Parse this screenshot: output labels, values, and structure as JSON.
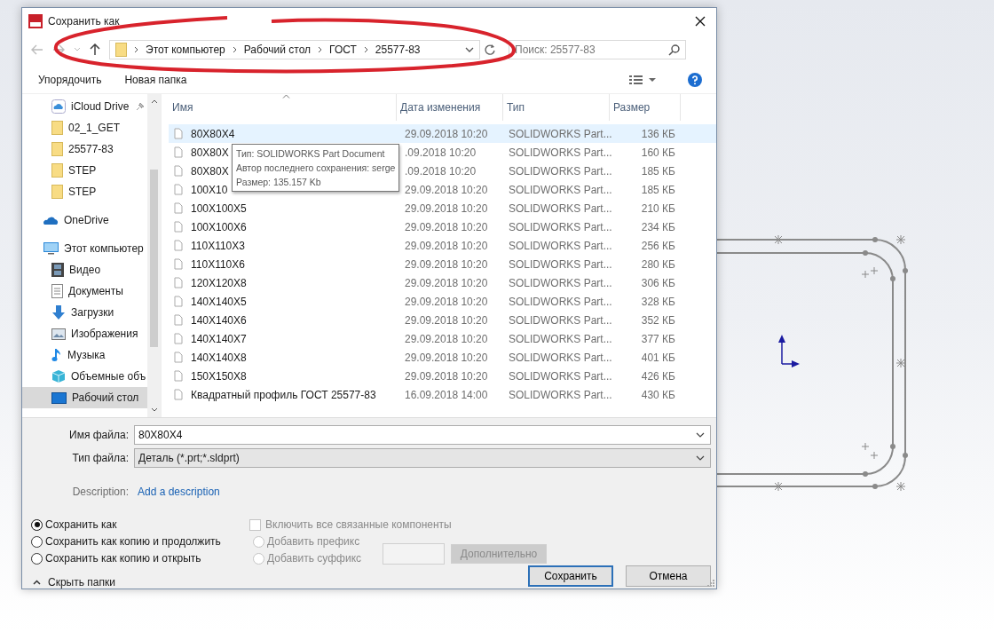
{
  "window": {
    "title": "Сохранить как"
  },
  "navigation": {
    "breadcrumb": [
      "Этот компьютер",
      "Рабочий стол",
      "ГОСТ",
      "25577-83"
    ],
    "search": {
      "placeholder": "Поиск: 25577-83"
    }
  },
  "toolbar": {
    "organize": "Упорядочить",
    "new_folder": "Новая папка"
  },
  "sidebar": {
    "quick_access_items": [
      {
        "label": "iCloud Drive",
        "kind": "cloud",
        "pinned": true,
        "selected": false
      },
      {
        "label": "02_1_GET",
        "kind": "folder",
        "pinned": false,
        "selected": false
      },
      {
        "label": "25577-83",
        "kind": "folder",
        "pinned": false,
        "selected": false
      },
      {
        "label": "STEP",
        "kind": "folder",
        "pinned": false,
        "selected": false
      },
      {
        "label": "STEP",
        "kind": "folder",
        "pinned": false,
        "selected": false
      }
    ],
    "items": [
      {
        "label": "OneDrive",
        "kind": "onedrive",
        "selected": false
      },
      {
        "label": "Этот компьютер",
        "kind": "computer",
        "selected": false,
        "children": [
          {
            "label": "Видео",
            "kind": "video",
            "selected": false
          },
          {
            "label": "Документы",
            "kind": "documents",
            "selected": false
          },
          {
            "label": "Загрузки",
            "kind": "downloads",
            "selected": false
          },
          {
            "label": "Изображения",
            "kind": "pictures",
            "selected": false
          },
          {
            "label": "Музыка",
            "kind": "music",
            "selected": false
          },
          {
            "label": "Объемные объ",
            "kind": "objects",
            "selected": false
          },
          {
            "label": "Рабочий стол",
            "kind": "desktop",
            "selected": true
          }
        ]
      }
    ]
  },
  "table": {
    "columns": [
      {
        "label": "Имя",
        "sorted": true
      },
      {
        "label": "Дата изменения",
        "sorted": false
      },
      {
        "label": "Тип",
        "sorted": false
      },
      {
        "label": "Размер",
        "sorted": false
      }
    ],
    "rows": [
      {
        "name": "80X80X4",
        "date": "29.09.2018 10:20",
        "type": "SOLIDWORKS Part...",
        "size": "136 КБ",
        "selected": true
      },
      {
        "name": "80X80X",
        "date": ".09.2018 10:20",
        "type": "SOLIDWORKS Part...",
        "size": "160 КБ",
        "selected": false
      },
      {
        "name": "80X80X",
        "date": ".09.2018 10:20",
        "type": "SOLIDWORKS Part...",
        "size": "185 КБ",
        "selected": false
      },
      {
        "name": "100X10",
        "date": "29.09.2018 10:20",
        "type": "SOLIDWORKS Part...",
        "size": "185 КБ",
        "selected": false
      },
      {
        "name": "100X100X5",
        "date": "29.09.2018 10:20",
        "type": "SOLIDWORKS Part...",
        "size": "210 КБ",
        "selected": false
      },
      {
        "name": "100X100X6",
        "date": "29.09.2018 10:20",
        "type": "SOLIDWORKS Part...",
        "size": "234 КБ",
        "selected": false
      },
      {
        "name": "110X110X3",
        "date": "29.09.2018 10:20",
        "type": "SOLIDWORKS Part...",
        "size": "256 КБ",
        "selected": false
      },
      {
        "name": "110X110X6",
        "date": "29.09.2018 10:20",
        "type": "SOLIDWORKS Part...",
        "size": "280 КБ",
        "selected": false
      },
      {
        "name": "120X120X8",
        "date": "29.09.2018 10:20",
        "type": "SOLIDWORKS Part...",
        "size": "306 КБ",
        "selected": false
      },
      {
        "name": "140X140X5",
        "date": "29.09.2018 10:20",
        "type": "SOLIDWORKS Part...",
        "size": "328 КБ",
        "selected": false
      },
      {
        "name": "140X140X6",
        "date": "29.09.2018 10:20",
        "type": "SOLIDWORKS Part...",
        "size": "352 КБ",
        "selected": false
      },
      {
        "name": "140X140X7",
        "date": "29.09.2018 10:20",
        "type": "SOLIDWORKS Part...",
        "size": "377 КБ",
        "selected": false
      },
      {
        "name": "140X140X8",
        "date": "29.09.2018 10:20",
        "type": "SOLIDWORKS Part...",
        "size": "401 КБ",
        "selected": false
      },
      {
        "name": "150X150X8",
        "date": "29.09.2018 10:20",
        "type": "SOLIDWORKS Part...",
        "size": "426 КБ",
        "selected": false
      },
      {
        "name": "Квадратный профиль ГОСТ 25577-83",
        "date": "16.09.2018 14:00",
        "type": "SOLIDWORKS Part...",
        "size": "430 КБ",
        "selected": false
      }
    ]
  },
  "tooltip": {
    "lines": [
      "Тип: SOLIDWORKS Part Document",
      "Автор последнего сохранения: serge",
      "Размер: 135.157 Kb"
    ]
  },
  "form": {
    "file_name": {
      "label": "Имя файла:",
      "value": "80X80X4"
    },
    "file_type": {
      "label": "Тип файла:",
      "value": "Деталь (*.prt;*.sldprt)"
    },
    "description": {
      "label": "Description:",
      "link": "Add a description"
    }
  },
  "save_options": [
    {
      "label": "Сохранить как",
      "selected": true
    },
    {
      "label": "Сохранить как копию и продолжить",
      "selected": false
    },
    {
      "label": "Сохранить как копию и открыть",
      "selected": false
    }
  ],
  "references": {
    "include_all": {
      "label": "Включить все связанные компоненты",
      "checked": false,
      "disabled": true
    },
    "affixes": [
      {
        "label": "Добавить префикс",
        "selected": false,
        "disabled": true
      },
      {
        "label": "Добавить суффикс",
        "selected": false,
        "disabled": true
      }
    ],
    "advanced_button": {
      "label": "Дополнительно",
      "disabled": true
    }
  },
  "hide_folders": "Скрыть папки",
  "buttons": [
    {
      "label": "Сохранить",
      "default": true
    },
    {
      "label": "Отмена",
      "default": false
    }
  ]
}
